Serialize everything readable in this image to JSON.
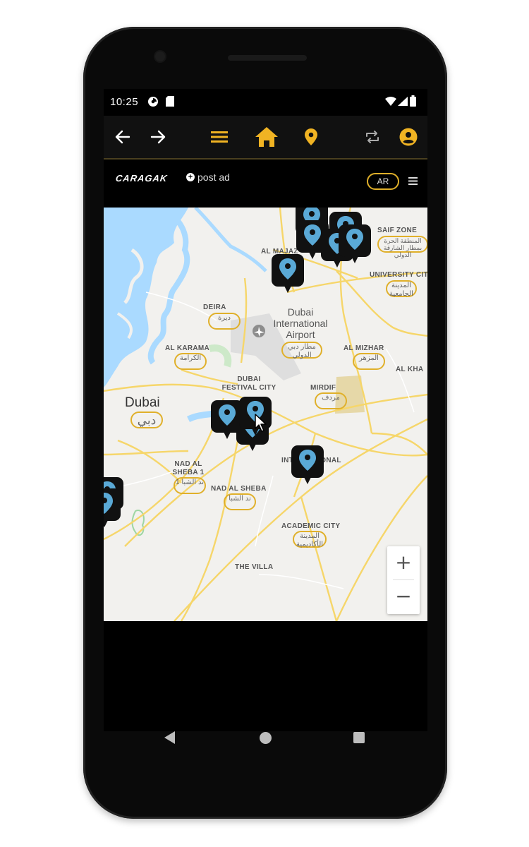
{
  "status": {
    "time": "10:25"
  },
  "header": {
    "icons": [
      "arrow-left-icon",
      "arrow-right-icon",
      "menu-icon",
      "home-icon",
      "location-pin-icon",
      "repeat-icon",
      "account-icon"
    ],
    "accent_color": "#f0b323"
  },
  "subheader": {
    "logo": "CARAGAK",
    "post_ad": "post ad",
    "language": "AR"
  },
  "map": {
    "labels": {
      "saif_zone": "SAIF ZONE",
      "saif_zone_ar": "المنطقة الحرة بمطار الشارقة الدولي",
      "al_majaz": "AL MAJAZ",
      "university_city": "UNIVERSITY CITY",
      "university_city_ar": "المدينة الجامعية",
      "deira": "DEIRA",
      "deira_ar": "ديرة",
      "airport": "Dubai International Airport",
      "airport_ar": "مطار دبي الدولي",
      "al_karama": "AL KARAMA",
      "al_karama_ar": "الكرامة",
      "al_mizhar": "AL MIZHAR",
      "al_mizhar_ar": "المزهر",
      "al_kha": "AL KHA",
      "festival_city": "DUBAI FESTIVAL CITY",
      "mirdif": "MIRDIF",
      "mirdif_ar": "مردف",
      "dubai": "Dubai",
      "dubai_ar": "دبي",
      "nad_al_sheba_1": "NAD AL SHEBA 1",
      "nad_al_sheba_1_ar": "ند الشبا 1",
      "international": "INTERNATIONAL",
      "nad_al_sheba": "NAD AL SHEBA",
      "nad_al_sheba_ar": "ند الشبا",
      "academic_city": "ACADEMIC CITY",
      "academic_city_ar": "المدينة الأكاديمية",
      "the_villa": "THE VILLA"
    },
    "zoom_in": "+",
    "zoom_out": "−",
    "marker_color": "#5aa9d6"
  }
}
